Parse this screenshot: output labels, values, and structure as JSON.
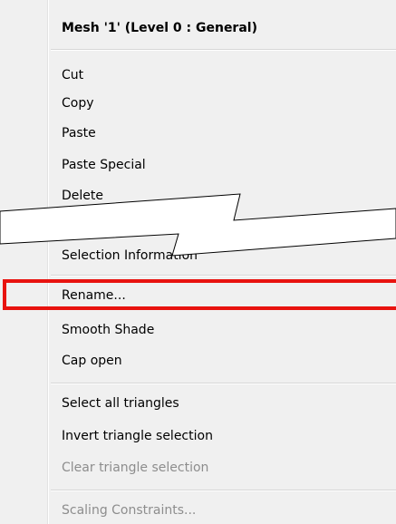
{
  "menu": {
    "header": "Mesh '1' (Level 0 : General)",
    "items": {
      "cut": "Cut",
      "copy": "Copy",
      "paste": "Paste",
      "paste_special": "Paste Special",
      "delete": "Delete",
      "selection_information": "Selection Information",
      "rename": "Rename...",
      "smooth_shade": "Smooth Shade",
      "cap_open": "Cap open",
      "select_all_triangles": "Select all triangles",
      "invert_triangle_selection": "Invert triangle selection",
      "clear_triangle_selection": "Clear triangle selection",
      "scaling_constraints": "Scaling Constraints..."
    },
    "disabled": [
      "clear_triangle_selection",
      "scaling_constraints"
    ],
    "highlighted": "rename",
    "colors": {
      "menu_background": "#f0f0f0",
      "highlight_outline": "#e8130f",
      "disabled_text": "#8d8d8d"
    }
  }
}
